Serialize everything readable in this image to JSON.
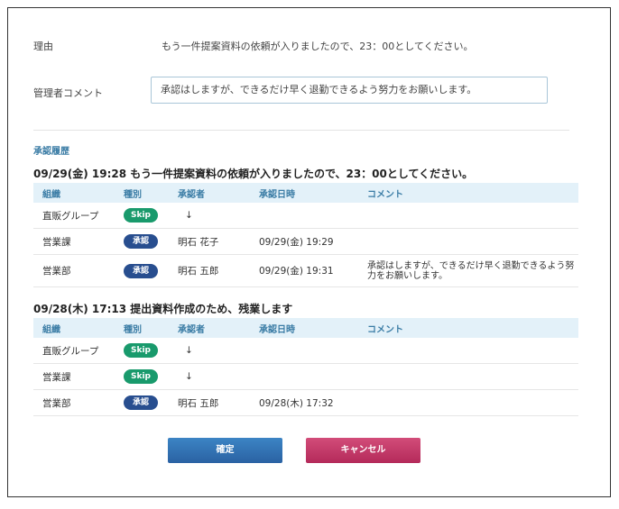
{
  "reason": {
    "label": "理由",
    "value": "もう一件提案資料の依頼が入りましたので、23：00としてください。"
  },
  "admin_comment": {
    "label": "管理者コメント",
    "value": "承認はしますが、できるだけ早く退勤できるよう努力をお願いします。"
  },
  "history_section_title": "承認履歴",
  "columns": [
    "組織",
    "種別",
    "承認者",
    "承認日時",
    "コメント"
  ],
  "histories": [
    {
      "header": "09/29(金) 19:28 もう一件提案資料の依頼が入りましたので、23：00としてください。",
      "rows": [
        {
          "org": "直販グループ",
          "type": "Skip",
          "approver": "↓",
          "date": "",
          "comment": ""
        },
        {
          "org": "営業課",
          "type": "承認",
          "approver": "明石 花子",
          "date": "09/29(金) 19:29",
          "comment": ""
        },
        {
          "org": "営業部",
          "type": "承認",
          "approver": "明石 五郎",
          "date": "09/29(金) 19:31",
          "comment": "承認はしますが、できるだけ早く退勤できるよう努力をお願いします。"
        }
      ]
    },
    {
      "header": "09/28(木) 17:13 提出資料作成のため、残業します",
      "rows": [
        {
          "org": "直販グループ",
          "type": "Skip",
          "approver": "↓",
          "date": "",
          "comment": ""
        },
        {
          "org": "営業課",
          "type": "Skip",
          "approver": "↓",
          "date": "",
          "comment": ""
        },
        {
          "org": "営業部",
          "type": "承認",
          "approver": "明石 五郎",
          "date": "09/28(木) 17:32",
          "comment": ""
        }
      ]
    }
  ],
  "buttons": {
    "confirm": "確定",
    "cancel": "キャンセル"
  },
  "colors": {
    "skip_badge": "#199a6c",
    "approve_badge": "#284e8f",
    "confirm_button": "#2f6fb3",
    "cancel_button": "#c43a69",
    "table_header_bg": "#e3f1f9"
  }
}
